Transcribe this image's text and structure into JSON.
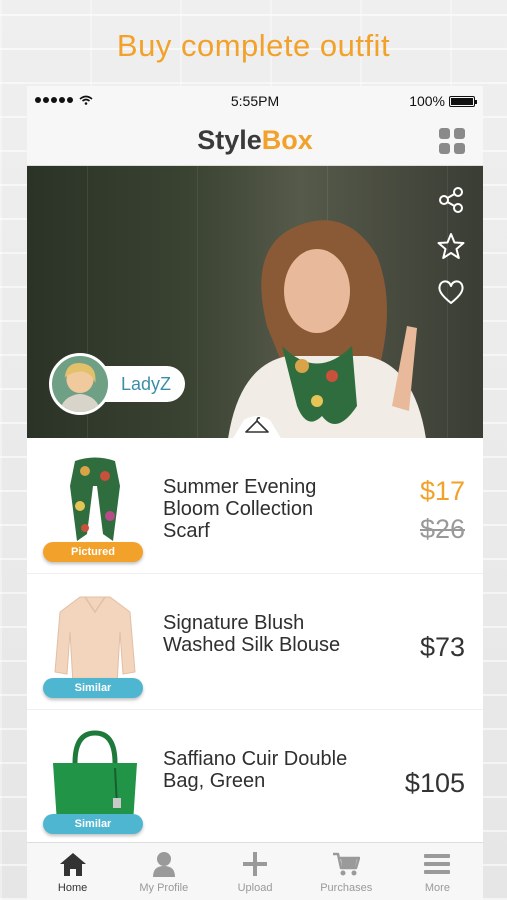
{
  "headline": "Buy complete outfit",
  "status_bar": {
    "time": "5:55PM",
    "battery": "100%"
  },
  "app": {
    "brand_part1": "Style",
    "brand_part2": "Box"
  },
  "hero": {
    "username": "LadyZ"
  },
  "products": [
    {
      "name": "Summer Evening Bloom Collection Scarf",
      "tag": "Pictured",
      "price": "$17",
      "old_price": "$26"
    },
    {
      "name": "Signature Blush Washed Silk Blouse",
      "tag": "Similar",
      "price": "$73"
    },
    {
      "name": "Saffiano Cuir Double Bag, Green",
      "tag": "Similar",
      "price": "$105"
    }
  ],
  "tabs": [
    {
      "label": "Home",
      "icon": "home-icon"
    },
    {
      "label": "My Profile",
      "icon": "profile-icon"
    },
    {
      "label": "Upload",
      "icon": "plus-icon"
    },
    {
      "label": "Purchases",
      "icon": "cart-icon"
    },
    {
      "label": "More",
      "icon": "menu-icon"
    }
  ],
  "colors": {
    "accent": "#f2a12a",
    "similar_tag": "#4fb6d1",
    "username": "#3b8ea8"
  }
}
